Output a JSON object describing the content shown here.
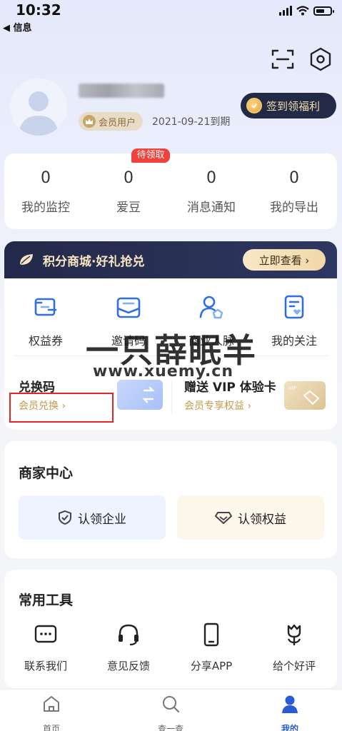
{
  "status_bar": {
    "time": "10:32",
    "back_label": "◀ 信息"
  },
  "profile": {
    "member_label": "会员用户",
    "expire_text": "2021-09-21到期",
    "signin_label": "签到领福利"
  },
  "stats": {
    "pending_tag": "待领取",
    "items": [
      {
        "value": "0",
        "label": "我的监控"
      },
      {
        "value": "0",
        "label": "爱豆"
      },
      {
        "value": "0",
        "label": "消息通知"
      },
      {
        "value": "0",
        "label": "我的导出"
      }
    ]
  },
  "mall": {
    "title": "积分商城·好礼抢兑",
    "view_label": "立即查看 ›",
    "grid": [
      {
        "label": "权益券",
        "icon": "coupon-icon"
      },
      {
        "label": "邀请码",
        "icon": "mail-icon"
      },
      {
        "label": "商业人脉",
        "icon": "contacts-icon"
      },
      {
        "label": "我的关注",
        "icon": "favorite-doc-icon"
      }
    ],
    "redeem": {
      "title": "兑换码",
      "sub": "会员兑换 ›"
    },
    "vip": {
      "title": "赠送 VIP 体验卡",
      "sub": "会员专享权益 ›"
    }
  },
  "watermark": {
    "text": "一只薛眠羊",
    "url": "www.xuemy.cn"
  },
  "merchant": {
    "title": "商家中心",
    "buttons": [
      {
        "label": "认领企业",
        "icon": "shield-check-icon",
        "bg": "#edf3ff"
      },
      {
        "label": "认领权益",
        "icon": "diamond-icon",
        "bg": "#fdf6ea"
      }
    ]
  },
  "tools": {
    "title": "常用工具",
    "items": [
      {
        "label": "联系我们",
        "icon": "chat-icon"
      },
      {
        "label": "意见反馈",
        "icon": "headset-icon"
      },
      {
        "label": "分享APP",
        "icon": "phone-icon"
      },
      {
        "label": "给个好评",
        "icon": "tulip-icon"
      }
    ]
  },
  "tabbar": {
    "items": [
      {
        "label": "首页",
        "icon": "home-icon"
      },
      {
        "label": "查一查",
        "icon": "search-icon"
      },
      {
        "label": "我的",
        "icon": "profile-icon",
        "active": true
      }
    ],
    "active_color": "#2a5bd7"
  }
}
